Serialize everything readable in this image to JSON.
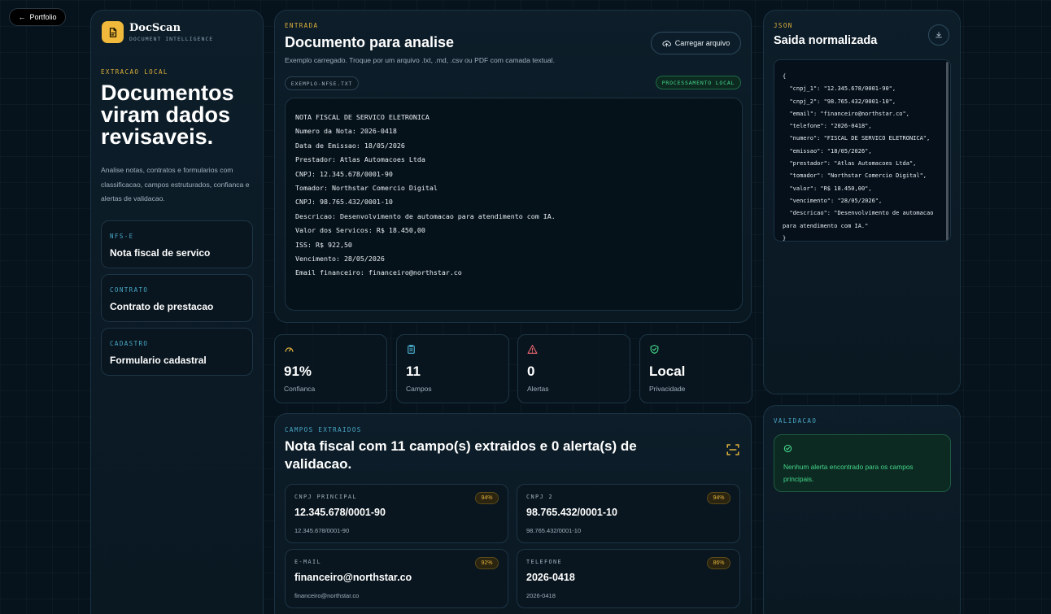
{
  "nav": {
    "back_label": "Portfolio"
  },
  "brand": {
    "name": "DocScan",
    "subtitle": "DOCUMENT INTELLIGENCE"
  },
  "hero": {
    "eyebrow": "EXTRACAO LOCAL",
    "title": "Documentos viram dados revisaveis.",
    "description": "Analise notas, contratos e formularios com classificacao, campos estruturados, confianca e alertas de validacao."
  },
  "doc_types": [
    {
      "tag": "NFS-E",
      "label": "Nota fiscal de servico"
    },
    {
      "tag": "CONTRATO",
      "label": "Contrato de prestacao"
    },
    {
      "tag": "CADASTRO",
      "label": "Formulario cadastral"
    }
  ],
  "input": {
    "eyebrow": "ENTRADA",
    "title": "Documento para analise",
    "subtitle": "Exemplo carregado. Troque por um arquivo .txt, .md, .csv ou PDF com camada textual.",
    "upload_label": "Carregar arquivo",
    "file_name": "EXEMPLO-NFSE.TXT",
    "processing_badge": "PROCESSAMENTO LOCAL",
    "lines": [
      "NOTA FISCAL DE SERVICO ELETRONICA",
      "Numero da Nota: 2026-0418",
      "Data de Emissao: 18/05/2026",
      "Prestador: Atlas Automacoes Ltda",
      "CNPJ: 12.345.678/0001-90",
      "Tomador: Northstar Comercio Digital",
      "CNPJ: 98.765.432/0001-10",
      "Descricao: Desenvolvimento de automacao para atendimento com IA.",
      "Valor dos Servicos: R$ 18.450,00",
      "ISS: R$ 922,50",
      "Vencimento: 28/05/2026",
      "Email financeiro: financeiro@northstar.co"
    ]
  },
  "stats": [
    {
      "value": "91%",
      "label": "Confianca",
      "icon": "gauge-icon",
      "color": "#e0b13c"
    },
    {
      "value": "11",
      "label": "Campos",
      "icon": "clipboard-icon",
      "color": "#49a8c8"
    },
    {
      "value": "0",
      "label": "Alertas",
      "icon": "warning-icon",
      "color": "#e0606a"
    },
    {
      "value": "Local",
      "label": "Privacidade",
      "icon": "shield-check-icon",
      "color": "#44d68a"
    }
  ],
  "fields": {
    "eyebrow": "CAMPOS EXTRAIDOS",
    "title": "Nota fiscal com 11 campo(s) extraidos e 0 alerta(s) de validacao.",
    "items": [
      {
        "name": "CNPJ PRINCIPAL",
        "value": "12.345.678/0001-90",
        "raw": "12.345.678/0001-90",
        "confidence": "94%"
      },
      {
        "name": "CNPJ 2",
        "value": "98.765.432/0001-10",
        "raw": "98.765.432/0001-10",
        "confidence": "94%"
      },
      {
        "name": "E-MAIL",
        "value": "financeiro@northstar.co",
        "raw": "financeiro@northstar.co",
        "confidence": "92%"
      },
      {
        "name": "TELEFONE",
        "value": "2026-0418",
        "raw": "2026-0418",
        "confidence": "86%"
      }
    ]
  },
  "json_output": {
    "eyebrow": "JSON",
    "title": "Saida normalizada",
    "lines": [
      "{",
      "  \"cnpj_1\": \"12.345.678/0001-90\",",
      "  \"cnpj_2\": \"98.765.432/0001-10\",",
      "  \"email\": \"financeiro@northstar.co\",",
      "  \"telefone\": \"2026-0418\",",
      "  \"numero\": \"FISCAL DE SERVICO ELETRONICA\",",
      "  \"emissao\": \"18/05/2026\",",
      "  \"prestador\": \"Atlas Automacoes Ltda\",",
      "  \"tomador\": \"Northstar Comercio Digital\",",
      "  \"valor\": \"R$ 18.450,00\",",
      "  \"vencimento\": \"28/05/2026\",",
      "  \"descricao\": \"Desenvolvimento de automacao para atendimento com IA.\"",
      "}"
    ]
  },
  "validation": {
    "eyebrow": "VALIDACAO",
    "message": "Nenhum alerta encontrado para os campos principais."
  }
}
